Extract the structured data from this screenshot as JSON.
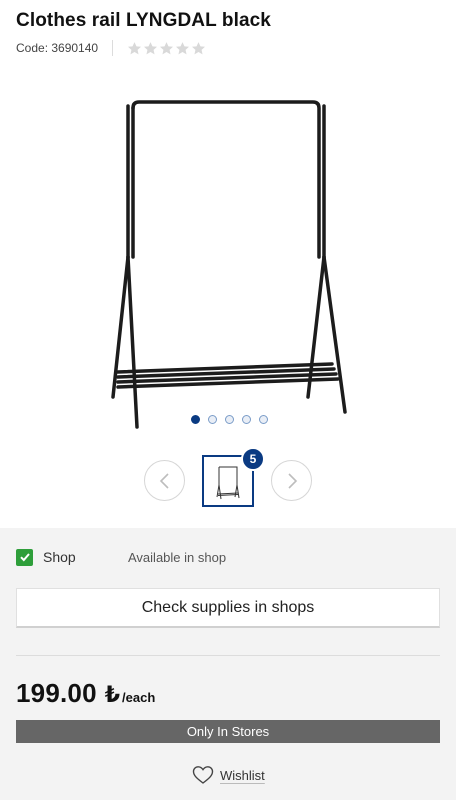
{
  "product": {
    "title": "Clothes rail LYNGDAL black",
    "code": "Code: 3690140",
    "rating_stars": 0,
    "rating_max": 5
  },
  "gallery": {
    "dots_count": 5,
    "active_dot": 0,
    "thumbnail_badge": "5",
    "prev_icon": "chevron-left-icon",
    "next_icon": "chevron-right-icon"
  },
  "availability": {
    "label": "Shop",
    "status": "Available in shop",
    "check_icon": "check-icon",
    "check_color": "#2e9e3a"
  },
  "actions": {
    "check_supplies_label": "Check supplies in shops",
    "stores_bar_label": "Only In Stores",
    "wishlist_label": "Wishlist",
    "wishlist_icon": "heart-icon"
  },
  "price": {
    "value": "199.00",
    "currency_symbol": "₺",
    "unit": "/each"
  },
  "colors": {
    "accent": "#0a3a82",
    "stores_bar": "#666666",
    "panel_bg": "#f3f3f3"
  }
}
